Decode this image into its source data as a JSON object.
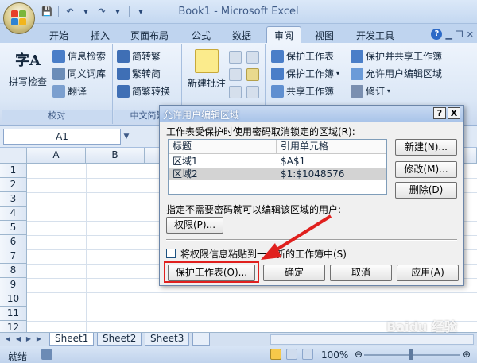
{
  "window": {
    "title": "Book1 - Microsoft Excel"
  },
  "ribbon": {
    "tabs": [
      "开始",
      "插入",
      "页面布局",
      "公式",
      "数据",
      "审阅",
      "视图",
      "开发工具"
    ],
    "active_tab": "审阅",
    "proofing": {
      "spell_check": "拼写检查",
      "research": "信息检索",
      "thesaurus": "同义词库",
      "translate": "翻译",
      "label": "校对"
    },
    "chinese": {
      "to_traditional": "简转繁",
      "to_simplified": "繁转简",
      "convert": "简繁转换",
      "label": "中文简繁"
    },
    "comments": {
      "new_comment": "新建批注"
    },
    "changes": {
      "protect_sheet": "保护工作表",
      "protect_workbook": "保护工作簿",
      "share_workbook": "共享工作簿",
      "protect_share": "保护并共享工作簿",
      "allow_edit_ranges": "允许用户编辑区域",
      "track_changes": "修订"
    },
    "sample_icon_text": "字A"
  },
  "formula_bar": {
    "name_box": "A1"
  },
  "grid": {
    "columns": [
      "A",
      "B"
    ],
    "rows": [
      "1",
      "2",
      "3",
      "4",
      "5",
      "6",
      "7",
      "8",
      "9",
      "10",
      "11",
      "12"
    ]
  },
  "sheets": [
    "Sheet1",
    "Sheet2",
    "Sheet3"
  ],
  "status": {
    "ready": "就绪",
    "zoom": "100%"
  },
  "dialog": {
    "title": "允许用户编辑区域",
    "help_btn": "?",
    "close_btn": "X",
    "ranges_label": "工作表受保护时使用密码取消锁定的区域(R):",
    "table": {
      "headers": [
        "标题",
        "引用单元格"
      ],
      "rows": [
        {
          "title": "区域1",
          "ref": "$A$1"
        },
        {
          "title": "区域2",
          "ref": "$1:$1048576"
        }
      ]
    },
    "new_btn": "新建(N)...",
    "modify_btn": "修改(M)...",
    "delete_btn": "删除(D)",
    "users_label": "指定不需要密码就可以编辑该区域的用户:",
    "permissions_btn": "权限(P)...",
    "paste_checkbox_label": "将权限信息粘贴到一个新的工作簿中(S)",
    "protect_sheet_btn": "保护工作表(O)...",
    "ok_btn": "确定",
    "cancel_btn": "取消",
    "apply_btn": "应用(A)"
  },
  "watermark": "Baidu 经验"
}
